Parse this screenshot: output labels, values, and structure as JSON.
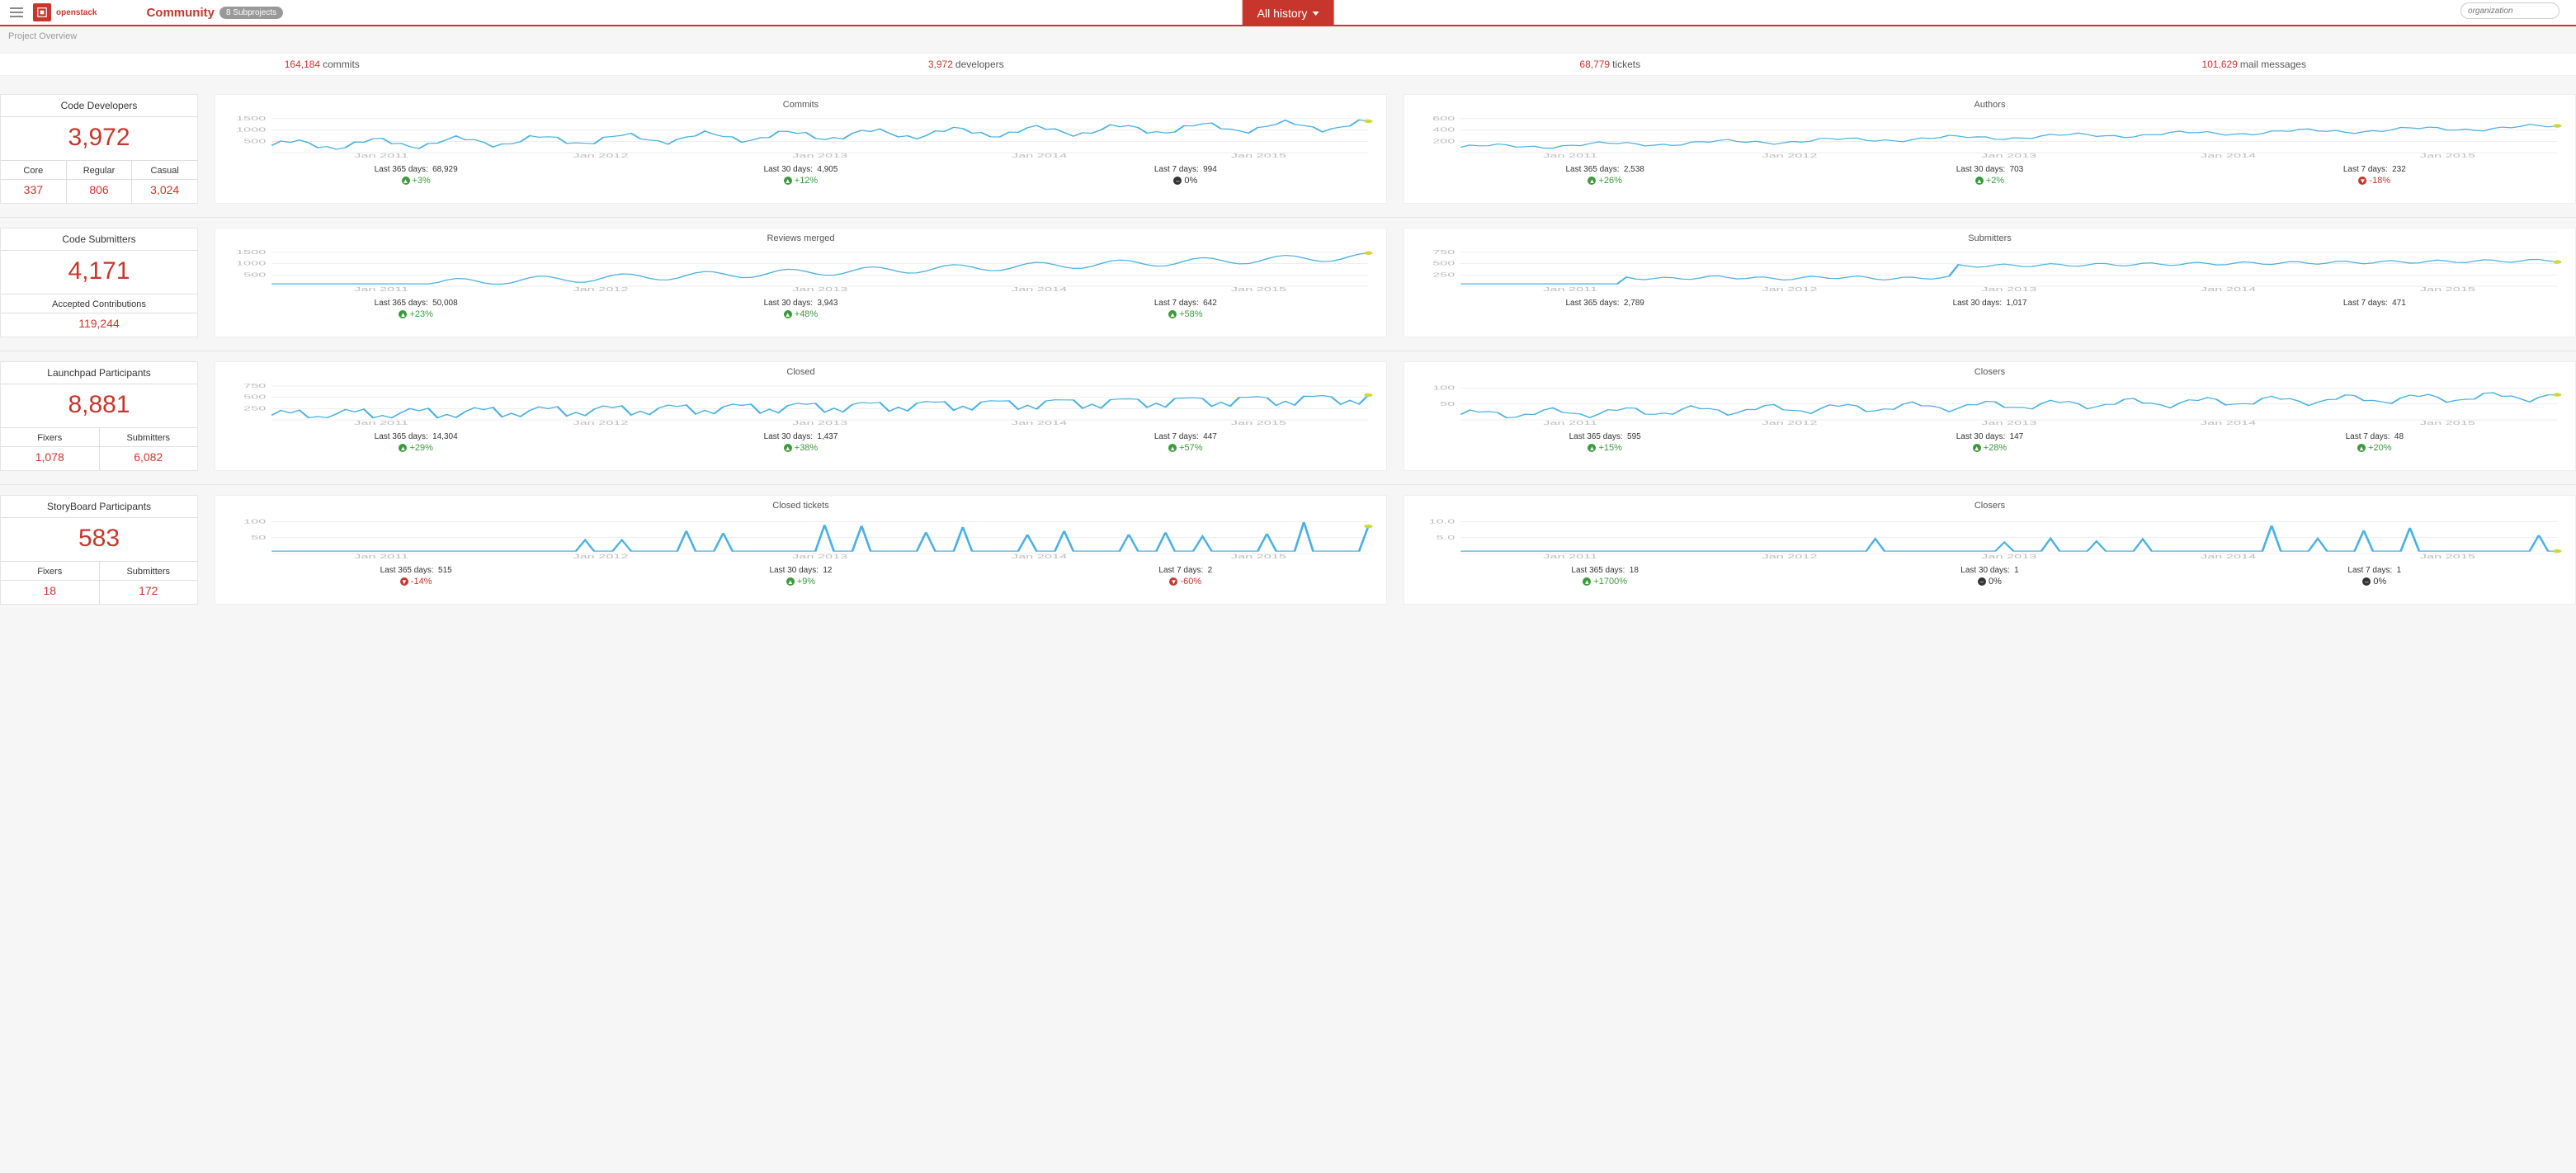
{
  "nav": {
    "brand": "openstack",
    "community_label": "Community",
    "subprojects_badge": "8 Subprojects",
    "history_label": "All history",
    "org_placeholder": "organization"
  },
  "breadcrumb": "Project Overview",
  "summary": [
    {
      "value": "164,184",
      "label": "commits"
    },
    {
      "value": "3,972",
      "label": "developers"
    },
    {
      "value": "68,779",
      "label": "tickets"
    },
    {
      "value": "101,629",
      "label": "mail messages"
    }
  ],
  "rows": [
    {
      "stat": {
        "title": "Code Developers",
        "big": "3,972",
        "sub": [
          {
            "label": "Core",
            "value": "337"
          },
          {
            "label": "Regular",
            "value": "806"
          },
          {
            "label": "Casual",
            "value": "3,024"
          }
        ]
      },
      "charts": [
        {
          "title": "Commits",
          "series": "growth_high",
          "yticks": [
            "500",
            "1000",
            "1500"
          ],
          "metrics": [
            {
              "label": "Last 365 days:",
              "value": "68,929",
              "delta": "+3%",
              "dir": "up"
            },
            {
              "label": "Last 30 days:",
              "value": "4,905",
              "delta": "+12%",
              "dir": "up"
            },
            {
              "label": "Last 7 days:",
              "value": "994",
              "delta": "0%",
              "dir": "zero"
            }
          ]
        },
        {
          "title": "Authors",
          "series": "growth_smooth",
          "yticks": [
            "200",
            "400",
            "600"
          ],
          "metrics": [
            {
              "label": "Last 365 days:",
              "value": "2,538",
              "delta": "+26%",
              "dir": "up"
            },
            {
              "label": "Last 30 days:",
              "value": "703",
              "delta": "+2%",
              "dir": "up"
            },
            {
              "label": "Last 7 days:",
              "value": "232",
              "delta": "-18%",
              "dir": "down"
            }
          ]
        }
      ]
    },
    {
      "stat": {
        "title": "Code Submitters",
        "big": "4,171",
        "sub": [
          {
            "label": "Accepted Contributions",
            "value": "119,244"
          }
        ]
      },
      "charts": [
        {
          "title": "Reviews merged",
          "series": "growth_delayed",
          "yticks": [
            "500",
            "1000",
            "1500"
          ],
          "metrics": [
            {
              "label": "Last 365 days:",
              "value": "50,008",
              "delta": "+23%",
              "dir": "up"
            },
            {
              "label": "Last 30 days:",
              "value": "3,943",
              "delta": "+48%",
              "dir": "up"
            },
            {
              "label": "Last 7 days:",
              "value": "642",
              "delta": "+58%",
              "dir": "up"
            }
          ]
        },
        {
          "title": "Submitters",
          "series": "growth_step",
          "yticks": [
            "250",
            "500",
            "750"
          ],
          "metrics": [
            {
              "label": "Last 365 days:",
              "value": "2,789",
              "delta": "",
              "dir": ""
            },
            {
              "label": "Last 30 days:",
              "value": "1,017",
              "delta": "",
              "dir": ""
            },
            {
              "label": "Last 7 days:",
              "value": "471",
              "delta": "",
              "dir": ""
            }
          ]
        }
      ]
    },
    {
      "stat": {
        "title": "Launchpad Participants",
        "big": "8,881",
        "sub": [
          {
            "label": "Fixers",
            "value": "1,078"
          },
          {
            "label": "Submitters",
            "value": "6,082"
          }
        ]
      },
      "charts": [
        {
          "title": "Closed",
          "series": "growth_noisy",
          "yticks": [
            "250",
            "500",
            "750"
          ],
          "metrics": [
            {
              "label": "Last 365 days:",
              "value": "14,304",
              "delta": "+29%",
              "dir": "up"
            },
            {
              "label": "Last 30 days:",
              "value": "1,437",
              "delta": "+38%",
              "dir": "up"
            },
            {
              "label": "Last 7 days:",
              "value": "447",
              "delta": "+57%",
              "dir": "up"
            }
          ]
        },
        {
          "title": "Closers",
          "series": "growth_mid",
          "yticks": [
            "50",
            "100"
          ],
          "metrics": [
            {
              "label": "Last 365 days:",
              "value": "595",
              "delta": "+15%",
              "dir": "up"
            },
            {
              "label": "Last 30 days:",
              "value": "147",
              "delta": "+28%",
              "dir": "up"
            },
            {
              "label": "Last 7 days:",
              "value": "48",
              "delta": "+20%",
              "dir": "up"
            }
          ]
        }
      ]
    },
    {
      "stat": {
        "title": "StoryBoard Participants",
        "big": "583",
        "sub": [
          {
            "label": "Fixers",
            "value": "18"
          },
          {
            "label": "Submitters",
            "value": "172"
          }
        ]
      },
      "charts": [
        {
          "title": "Closed tickets",
          "series": "spiky",
          "yticks": [
            "50",
            "100"
          ],
          "metrics": [
            {
              "label": "Last 365 days:",
              "value": "515",
              "delta": "-14%",
              "dir": "down"
            },
            {
              "label": "Last 30 days:",
              "value": "12",
              "delta": "+9%",
              "dir": "up"
            },
            {
              "label": "Last 7 days:",
              "value": "2",
              "delta": "-60%",
              "dir": "down"
            }
          ]
        },
        {
          "title": "Closers",
          "series": "spiky2",
          "yticks": [
            "5.0",
            "10.0"
          ],
          "metrics": [
            {
              "label": "Last 365 days:",
              "value": "18",
              "delta": "+1700%",
              "dir": "up"
            },
            {
              "label": "Last 30 days:",
              "value": "1",
              "delta": "0%",
              "dir": "zero"
            },
            {
              "label": "Last 7 days:",
              "value": "1",
              "delta": "0%",
              "dir": "zero"
            }
          ]
        }
      ]
    }
  ],
  "xticks": [
    "Jan 2011",
    "Jan 2012",
    "Jan 2013",
    "Jan 2014",
    "Jan 2015"
  ],
  "chart_data": [
    {
      "type": "line",
      "title": "Commits",
      "x_labels": [
        "Jan 2011",
        "Jan 2012",
        "Jan 2013",
        "Jan 2014",
        "Jan 2015"
      ],
      "ylim": [
        0,
        1500
      ],
      "values_approx": "weekly commit count rising from ~100 in 2010 to ~900–1200 by 2014–2015 with weekly oscillation"
    },
    {
      "type": "line",
      "title": "Authors",
      "x_labels": [
        "Jan 2011",
        "Jan 2012",
        "Jan 2013",
        "Jan 2014",
        "Jan 2015"
      ],
      "ylim": [
        0,
        600
      ],
      "values_approx": "weekly distinct authors rising from ~30 to ~350–450 by 2015"
    },
    {
      "type": "line",
      "title": "Reviews merged",
      "x_labels": [
        "Jan 2011",
        "Jan 2012",
        "Jan 2013",
        "Jan 2014",
        "Jan 2015"
      ],
      "ylim": [
        0,
        1500
      ],
      "values_approx": "near-zero until mid-2011, then rising to ~800–1200 by 2015"
    },
    {
      "type": "line",
      "title": "Submitters",
      "x_labels": [
        "Jan 2011",
        "Jan 2012",
        "Jan 2013",
        "Jan 2014",
        "Jan 2015"
      ],
      "ylim": [
        0,
        750
      ],
      "values_approx": "near-zero until mid-2011, step to ~150, rising to ~500 by 2015"
    },
    {
      "type": "line",
      "title": "Closed",
      "x_labels": [
        "Jan 2011",
        "Jan 2012",
        "Jan 2013",
        "Jan 2014",
        "Jan 2015"
      ],
      "ylim": [
        0,
        750
      ],
      "values_approx": "rising from ~20 to ~300–450 by 2015, noisy weekly"
    },
    {
      "type": "line",
      "title": "Closers",
      "x_labels": [
        "Jan 2011",
        "Jan 2012",
        "Jan 2013",
        "Jan 2014",
        "Jan 2015"
      ],
      "ylim": [
        0,
        100
      ],
      "values_approx": "rising from ~5 to ~60–80 by 2015"
    },
    {
      "type": "line",
      "title": "Closed tickets",
      "x_labels": [
        "Jan 2011",
        "Jan 2012",
        "Jan 2013",
        "Jan 2014",
        "Jan 2015"
      ],
      "ylim": [
        0,
        100
      ],
      "values_approx": "mostly 0 with intermittent spikes 10–80 starting 2012"
    },
    {
      "type": "line",
      "title": "Closers (StoryBoard)",
      "x_labels": [
        "Jan 2011",
        "Jan 2012",
        "Jan 2013",
        "Jan 2014",
        "Jan 2015"
      ],
      "ylim": [
        0,
        10
      ],
      "values_approx": "mostly 0 with small spikes 1–10, more frequent after 2014"
    }
  ]
}
